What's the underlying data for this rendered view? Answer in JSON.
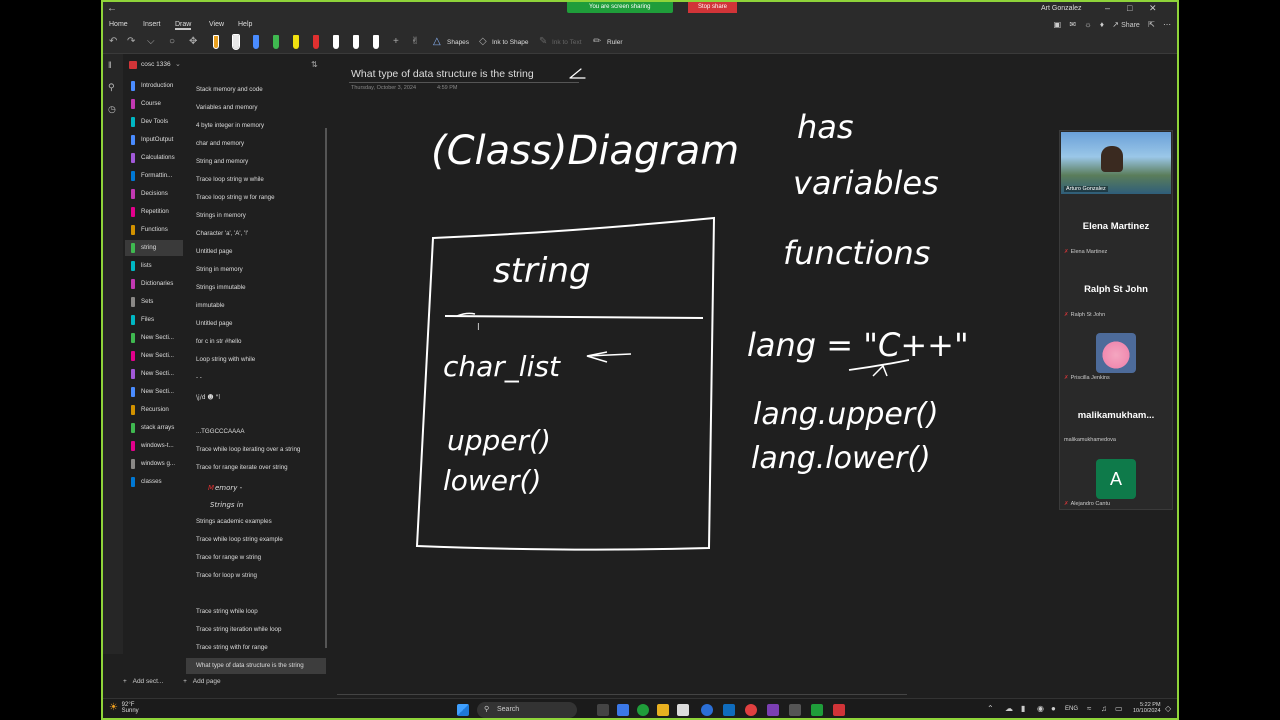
{
  "titlebar": {
    "back_icon": "back-arrow-icon",
    "share_banner": "You are screen sharing",
    "stop_share": "Stop share",
    "user_name": "Art Gonzalez"
  },
  "menu": {
    "items": [
      "Home",
      "Insert",
      "Draw",
      "View",
      "Help"
    ],
    "active": "Draw",
    "share": "Share"
  },
  "toolbar": {
    "shapes": "Shapes",
    "ink_to_shape": "Ink to Shape",
    "ink_to_text": "Ink to Text",
    "ruler": "Ruler",
    "pen_colors": [
      "#e8e8e8",
      "#e8e8e8",
      "#4a8cff",
      "#3fb950",
      "#f0e010",
      "#e03030",
      "#ffffff",
      "#ffffff",
      "#ffffff"
    ]
  },
  "notebook": {
    "name": "cosc 1336"
  },
  "sections": [
    {
      "label": "Introduction",
      "color": "#4a8cff"
    },
    {
      "label": "Course",
      "color": "#c239b3"
    },
    {
      "label": "Dev Tools",
      "color": "#00b7c3"
    },
    {
      "label": "InputOutput",
      "color": "#4a8cff"
    },
    {
      "label": "Calculations",
      "color": "#a259d9"
    },
    {
      "label": "Formattin...",
      "color": "#0078d4"
    },
    {
      "label": "Decisions",
      "color": "#c239b3"
    },
    {
      "label": "Repetition",
      "color": "#e3008c"
    },
    {
      "label": "Functions",
      "color": "#d29200"
    },
    {
      "label": "string",
      "color": "#3fb950"
    },
    {
      "label": "lists",
      "color": "#00b7c3"
    },
    {
      "label": "Dictionaries",
      "color": "#c239b3"
    },
    {
      "label": "Sets",
      "color": "#8a8886"
    },
    {
      "label": "Files",
      "color": "#00b7c3"
    },
    {
      "label": "New Secti...",
      "color": "#3fb950"
    },
    {
      "label": "New Secti...",
      "color": "#e3008c"
    },
    {
      "label": "New Secti...",
      "color": "#a259d9"
    },
    {
      "label": "New Secti...",
      "color": "#4a8cff"
    },
    {
      "label": "Recursion",
      "color": "#d29200"
    },
    {
      "label": "stack arrays",
      "color": "#3fb950"
    },
    {
      "label": "windows-t...",
      "color": "#e3008c"
    },
    {
      "label": "windows g...",
      "color": "#8a8886"
    },
    {
      "label": "classes",
      "color": "#0078d4"
    }
  ],
  "active_section": "string",
  "pages": [
    "Stack memory and code",
    "Variables and memory",
    "4 byte integer in memory",
    "char and memory",
    "String and memory",
    "Trace loop string w while",
    "Trace loop string w for range",
    "Strings in memory",
    "Character 'a', 'A', '!'",
    "Untitled page",
    "String in memory",
    "Strings immutable",
    "immutable",
    "Untitled page",
    "for c in str #hello",
    "Loop string with while",
    "- -",
    "",
    "",
    "...TGGCCCAAAA",
    "Trace while loop iterating over a string",
    "Trace for range iterate over string",
    "",
    "",
    "Strings academic examples",
    "Trace while loop string example",
    "Trace for range w string",
    "Trace for loop w string",
    "",
    "Trace string while loop",
    "Trace string iteration while loop",
    "Trace string with for range",
    "What type of data structure is the string"
  ],
  "footer": {
    "add_section": "Add sect...",
    "add_page": "Add page"
  },
  "page": {
    "title": "What type of data structure is the string",
    "date": "Thursday, October 3, 2024",
    "time": "4:59 PM"
  },
  "ink": {
    "heading": "(Class)Diagram",
    "class_name": "string",
    "attribute": "char_list",
    "method_1": "upper()",
    "method_2": "lower()",
    "note_1": "has",
    "note_2": "variables",
    "note_3": "functions",
    "code_1": "lang = \"C++\"",
    "code_2": "lang.upper()",
    "code_3": "lang.lower()"
  },
  "meeting": {
    "video_label": "Arturo Gonzalez",
    "participants": [
      {
        "big": "Elena Martinez",
        "small": "Elena Martinez"
      },
      {
        "big": "Ralph St John",
        "small": "Ralph St John"
      },
      {
        "big": "",
        "small": "Priscilla Jenkins"
      },
      {
        "big": "malikamukham...",
        "small": "malikamukhamedova"
      },
      {
        "big": "A",
        "small": "Alejandro Cantu"
      }
    ]
  },
  "taskbar": {
    "temp": "92°F",
    "weather": "Sunny",
    "search": "Search",
    "lang": "ENG",
    "time": "5:22 PM",
    "date": "10/10/2024"
  }
}
